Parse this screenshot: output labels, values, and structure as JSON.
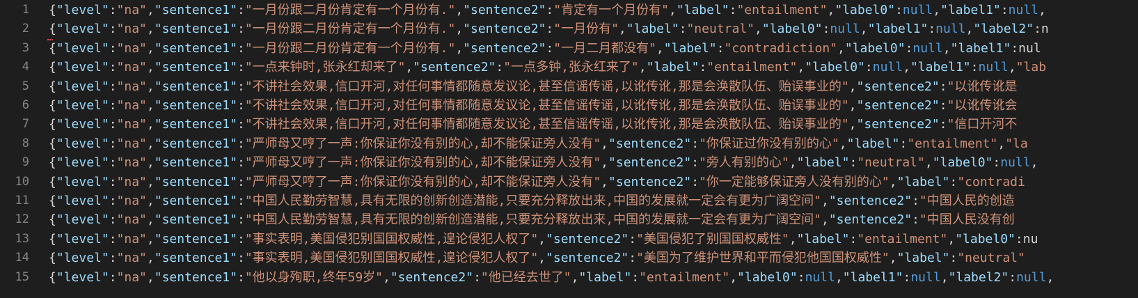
{
  "editor": {
    "colors": {
      "background": "#1e1e1e",
      "line_number": "#858585",
      "key": "#9cdcfe",
      "string": "#ce9178",
      "null": "#569cd6",
      "punctuation": "#d4d4d4"
    },
    "lines": [
      {
        "number": "1",
        "text": "{\"level\":\"na\",\"sentence1\":\"一月份跟二月份肯定有一个月份有.\",\"sentence2\":\"肯定有一个月份有\",\"label\":\"entailment\",\"label0\":null,\"label1\":null,"
      },
      {
        "number": "2",
        "text": "{\"level\":\"na\",\"sentence1\":\"一月份跟二月份肯定有一个月份有.\",\"sentence2\":\"一月份有\",\"label\":\"neutral\",\"label0\":null,\"label1\":null,\"label2\":n"
      },
      {
        "number": "3",
        "text": "{\"level\":\"na\",\"sentence1\":\"一月份跟二月份肯定有一个月份有.\",\"sentence2\":\"一月二月都没有\",\"label\":\"contradiction\",\"label0\":null,\"label1\":nul"
      },
      {
        "number": "4",
        "text": "{\"level\":\"na\",\"sentence1\":\"一点来钟时,张永红却来了\",\"sentence2\":\"一点多钟,张永红来了\",\"label\":\"entailment\",\"label0\":null,\"label1\":null,\"lab"
      },
      {
        "number": "5",
        "text": "{\"level\":\"na\",\"sentence1\":\"不讲社会效果,信口开河,对任何事情都随意发议论,甚至信谣传谣,以讹传讹,那是会涣散队伍、贻误事业的\",\"sentence2\":\"以讹传讹是"
      },
      {
        "number": "6",
        "text": "{\"level\":\"na\",\"sentence1\":\"不讲社会效果,信口开河,对任何事情都随意发议论,甚至信谣传谣,以讹传讹,那是会涣散队伍、贻误事业的\",\"sentence2\":\"以讹传讹会"
      },
      {
        "number": "7",
        "text": "{\"level\":\"na\",\"sentence1\":\"不讲社会效果,信口开河,对任何事情都随意发议论,甚至信谣传谣,以讹传讹,那是会涣散队伍、贻误事业的\",\"sentence2\":\"信口开河不"
      },
      {
        "number": "8",
        "text": "{\"level\":\"na\",\"sentence1\":\"严师母又哼了一声:你保证你没有别的心,却不能保证旁人没有\",\"sentence2\":\"你保证过你没有别的心\",\"label\":\"entailment\",\"la"
      },
      {
        "number": "9",
        "text": "{\"level\":\"na\",\"sentence1\":\"严师母又哼了一声:你保证你没有别的心,却不能保证旁人没有\",\"sentence2\":\"旁人有别的心\",\"label\":\"neutral\",\"label0\":null,"
      },
      {
        "number": "10",
        "text": "{\"level\":\"na\",\"sentence1\":\"严师母又哼了一声:你保证你没有别的心,却不能保证旁人没有\",\"sentence2\":\"你一定能够保证旁人没有别的心\",\"label\":\"contradi"
      },
      {
        "number": "11",
        "text": "{\"level\":\"na\",\"sentence1\":\"中国人民勤劳智慧,具有无限的创新创造潜能,只要充分释放出来,中国的发展就一定会有更为广阔空间\",\"sentence2\":\"中国人民的创造"
      },
      {
        "number": "12",
        "text": "{\"level\":\"na\",\"sentence1\":\"中国人民勤劳智慧,具有无限的创新创造潜能,只要充分释放出来,中国的发展就一定会有更为广阔空间\",\"sentence2\":\"中国人民没有创"
      },
      {
        "number": "13",
        "text": "{\"level\":\"na\",\"sentence1\":\"事实表明,美国侵犯别国国权威性,遑论侵犯人权了\",\"sentence2\":\"美国侵犯了别国国权威性\",\"label\":\"entailment\",\"label0\":nu"
      },
      {
        "number": "14",
        "text": "{\"level\":\"na\",\"sentence1\":\"事实表明,美国侵犯别国国权威性,遑论侵犯人权了\",\"sentence2\":\"美国为了维护世界和平而侵犯他国国权威性\",\"label\":\"neutral\""
      },
      {
        "number": "15",
        "text": "{\"level\":\"na\",\"sentence1\":\"他以身殉职,终年59岁\",\"sentence2\":\"他已经去世了\",\"label\":\"entailment\",\"label0\":null,\"label1\":null,\"label2\":null,"
      }
    ]
  }
}
